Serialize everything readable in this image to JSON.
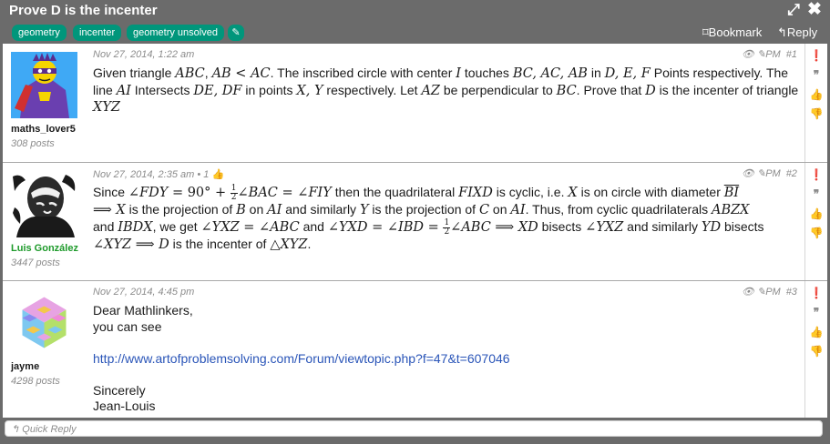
{
  "window": {
    "title": "Prove D is the incenter",
    "expand_icon": "expand-icon",
    "close_icon": "close-icon"
  },
  "tags": [
    "geometry",
    "incenter",
    "geometry unsolved"
  ],
  "tag_edit_icon": "pencil-icon",
  "actions": {
    "bookmark": "Bookmark",
    "reply": "Reply",
    "bookmark_icon": "bookmark-icon",
    "reply_icon": "reply-icon"
  },
  "post_tools": {
    "pm": "PM"
  },
  "posts": [
    {
      "author": "maths_lover5",
      "posts_count": "308 posts",
      "date": "Nov 27, 2014, 1:22 am",
      "number": "#1",
      "avatar": "cartoon-hero-avatar"
    },
    {
      "author": "Luis González",
      "posts_count": "3447 posts",
      "date": "Nov 27, 2014, 2:35 am",
      "likes": "• 1",
      "number": "#2",
      "avatar": "bw-portrait-avatar"
    },
    {
      "author": "jayme",
      "posts_count": "4298 posts",
      "date": "Nov 27, 2014, 4:45 pm",
      "number": "#3",
      "avatar": "cube-pattern-avatar",
      "lines": {
        "greeting": "Dear Mathlinkers,",
        "see": "you can see",
        "link": "http://www.artofproblemsolving.com/Forum/viewtopic.php?f=47&t=607046",
        "closing": "Sincerely",
        "signature": "Jean-Louis"
      }
    }
  ],
  "quick_reply": "Quick Reply",
  "colors": {
    "tag": "#00967b",
    "frame": "#6b6b6b",
    "link": "#2a55b8",
    "username_green": "#1d9a2a"
  }
}
